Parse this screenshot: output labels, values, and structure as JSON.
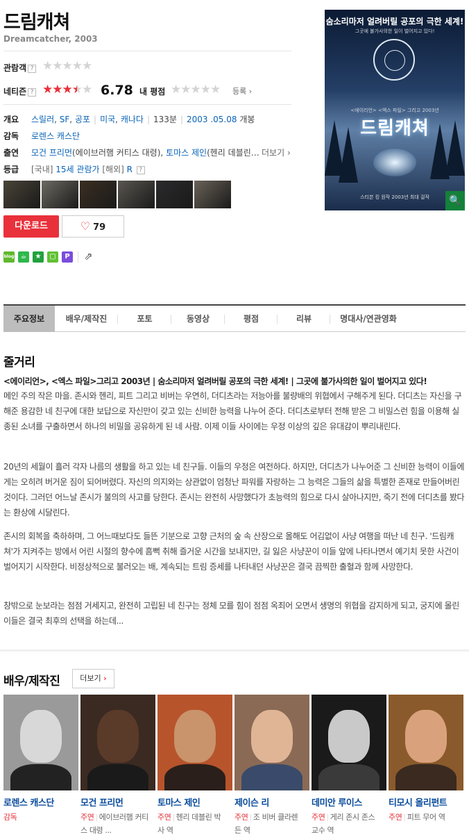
{
  "header": {
    "title": "드림캐쳐",
    "subtitle": "Dreamcatcher, 2003"
  },
  "ratings": {
    "audience_label": "관람객",
    "audience_stars": 0,
    "netizen_label": "네티즌",
    "netizen_stars": 3.4,
    "netizen_score": "6.78",
    "my_label": "내 평점",
    "register_label": "등록",
    "help": "?"
  },
  "info": {
    "overview_label": "개요",
    "genres": [
      "스릴러",
      "SF",
      "공포"
    ],
    "countries": [
      "미국",
      "캐나다"
    ],
    "runtime": "133분",
    "release_date": "2003 .05.08",
    "release_suffix": "개봉",
    "director_label": "감독",
    "director": "로렌스 캐스단",
    "cast_label": "출연",
    "cast_1": "모건 프리먼",
    "cast_1_role": "(에이브러햄 커티스 대령)",
    "cast_2": "토마스 제인",
    "cast_2_role": "(헨리 데블린…",
    "more_label": "더보기",
    "grade_label": "등급",
    "grade_prefix": "[국내]",
    "grade_kr": "15세 관람가",
    "grade_intl_prefix": "[해외]",
    "grade_intl": "R"
  },
  "thumbnails": [
    {
      "name": "still-1",
      "color": "#4a4438"
    },
    {
      "name": "still-2",
      "color": "#6d6a62"
    },
    {
      "name": "still-3",
      "color": "#3a2e22"
    },
    {
      "name": "still-4",
      "color": "#5a5650"
    },
    {
      "name": "still-5",
      "color": "#2b2a2c"
    },
    {
      "name": "still-6",
      "color": "#6a6258"
    }
  ],
  "actions": {
    "download_label": "다운로드",
    "like_count": "79"
  },
  "share_icons": [
    {
      "name": "blog-share-icon",
      "color": "#5fb82e",
      "glyph": "blog"
    },
    {
      "name": "cafe-share-icon",
      "color": "#2eb84a",
      "glyph": "☕"
    },
    {
      "name": "star-share-icon",
      "color": "#21a13c",
      "glyph": "★"
    },
    {
      "name": "memo-share-icon",
      "color": "#5fc234",
      "glyph": "▢"
    },
    {
      "name": "keep-share-icon",
      "color": "#7a4cdc",
      "glyph": "P"
    }
  ],
  "poster": {
    "tagline": "숨소리마저 얼려버릴 공포의 극한 세계!",
    "sub_tagline": "그곳에 불가사의한 일이 벌어지고 있다!",
    "credit": "<에이리언> <엑스 파일> 그리고 2003년",
    "title": "드림캐쳐",
    "footer": "스티븐 킹 원작 2003년 최대 걸작"
  },
  "tabs": [
    "주요정보",
    "배우/제작진",
    "포토",
    "동영상",
    "평점",
    "리뷰",
    "명대사/연관영화"
  ],
  "synopsis": {
    "heading": "줄거리",
    "lead": "<에이리언>, <엑스 파일>그리고 2003년 | 숨소리마저 얼려버릴 공포의 극한 세계! | 그곳에 불가사의한 일이 벌어지고 있다!",
    "p1": "메인 주의 작은 마을. 존시와 헨리, 피트 그리고 비버는 우연히, 더디츠라는 저능아를 불량배의 위협에서 구해주게 된다. 더디츠는 자신을 구해준 용감한 네 친구에 대한 보답으로 자신만이 갖고 있는 신비한 능력을 나누어 준다. 더디츠로부터 전해 받은 그 비밀스런 힘을 이용해 실종된 소녀를 구출하면서 하나의 비밀을 공유하게 된 네 사람. 이제 이들 사이에는 우정 이상의 깊은 유대감이 뿌리내린다.",
    "p2": " 20년의 세월이 흘러 각자 나름의 생활을 하고 있는 네 친구들. 이들의 우정은 여전하다. 하지만, 더디츠가 나누어준 그 신비한 능력이 이들에게는 오히려 버거운 짐이 되어버렸다. 자신의 의지와는 상관없이 엄청난 파워를 자랑하는 그 능력은 그들의 삶을 특별한 존재로 만들어버린 것이다. 그러던 어느날 존시가 불의의 사고를 당한다. 존시는 완전히 사망했다가 초능력의 힘으로 다시 살아나지만, 죽기 전에 더디츠를 봤다는 환상에 시달린다.",
    "p3": "  존시의 회복을 축하하며, 그 어느때보다도 들뜬 기분으로 고향 근처의 숲 속 산장으로 올해도 어김없이 사냥 여행을 떠난 네 친구. '드림캐쳐'가 지켜주는 방에서 어린 시절의 향수에 흠뻑 취해 즐거운 시간을 보내지만, 길 잃은 사냥꾼이 이들 앞에 나타나면서 예기치 못한 사건이 벌어지기 시작한다. 비정상적으로 불러오는 배, 계속되는 트림 증세를 나타내던 사냥꾼은 결국 끔찍한 출혈과 함께 사망한다.",
    "p4": "  창밖으로 눈보라는 점점 거세지고, 완전히 고립된 네 친구는 정체 모를 힘이 점점 옥죄어 오면서 생명의 위협을 감지하게 되고, 궁지에 몰린 이들은 결국 최후의 선택을 하는데..."
  },
  "cast_section": {
    "heading": "배우/제작진",
    "more_label": "더보기",
    "people": [
      {
        "name": "로렌스 캐스단",
        "role": "감독",
        "character": "",
        "bg": "#9a9a9a",
        "face": "#d8d8d8",
        "body": "#222222"
      },
      {
        "name": "모건 프리먼",
        "role": "주연",
        "character": "에이브러햄 커티스 대령 ...",
        "bg": "#3a2a22",
        "face": "#5a3a28",
        "body": "#1a1a1a"
      },
      {
        "name": "토마스 제인",
        "role": "주연",
        "character": "헨리 데블린 박사 역",
        "bg": "#b7542c",
        "face": "#c9936c",
        "body": "#2a1f1a"
      },
      {
        "name": "제이슨 리",
        "role": "주연",
        "character": "조 비버 클라렌든 역",
        "bg": "#8a6a55",
        "face": "#e0b596",
        "body": "#3a4a6a"
      },
      {
        "name": "데미안 루이스",
        "role": "주연",
        "character": "게리 존시 존스 교수 역",
        "bg": "#1a1a1a",
        "face": "#c9c9c9",
        "body": "#3a3a3a"
      },
      {
        "name": "티모시 올리펀트",
        "role": "주연",
        "character": "피트 무어 역",
        "bg": "#8a5a2c",
        "face": "#d9a27d",
        "body": "#3a2a20"
      }
    ]
  }
}
